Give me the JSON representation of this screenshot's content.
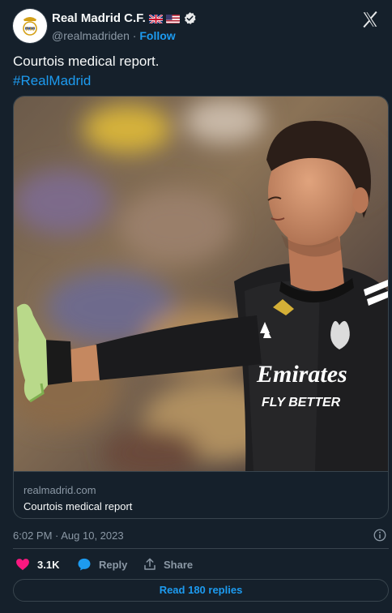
{
  "header": {
    "account_name": "Real Madrid C.F.",
    "handle": "@realmadriden",
    "separator": " · ",
    "follow_label": "Follow"
  },
  "tweet": {
    "text": "Courtois medical report.",
    "hashtag": "#RealMadrid"
  },
  "link_card": {
    "domain": "realmadrid.com",
    "title": "Courtois medical report"
  },
  "jersey": {
    "sponsor_line1": "Emirates",
    "sponsor_line2": "FLY BETTER"
  },
  "meta": {
    "timestamp": "6:02 PM · Aug 10, 2023"
  },
  "actions": {
    "likes": "3.1K",
    "reply_label": "Reply",
    "share_label": "Share"
  },
  "footer": {
    "read_replies": "Read 180 replies"
  },
  "colors": {
    "background": "#15202b",
    "accent": "#1d9bf0",
    "like": "#f91880",
    "secondary_text": "#8b98a5",
    "border": "#38444d"
  },
  "icons": [
    "real-madrid-crest-icon",
    "uk-flag-icon",
    "us-flag-icon",
    "verified-badge-icon",
    "x-logo-icon",
    "info-icon",
    "heart-icon",
    "reply-bubble-icon",
    "share-icon"
  ]
}
